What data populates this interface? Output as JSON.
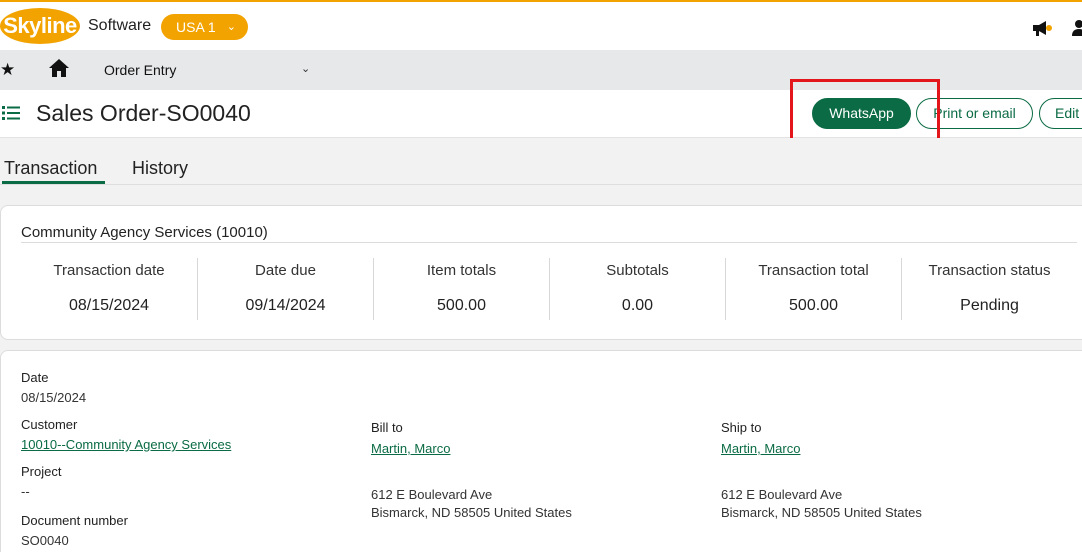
{
  "header": {
    "logo_text": "Skyline",
    "brand_text": "Software",
    "company": "USA 1",
    "company_chevron": "⌄"
  },
  "nav": {
    "star": "★",
    "label": "Order Entry",
    "chevron": "⌄"
  },
  "title": {
    "text": "Sales Order-SO0040",
    "buttons": {
      "whatsapp": "WhatsApp",
      "print": "Print or email",
      "edit": "Edit"
    }
  },
  "tabs": [
    {
      "label": "Transaction",
      "active": true
    },
    {
      "label": "History",
      "active": false
    }
  ],
  "summary": {
    "title": "Community Agency Services (10010)",
    "stats": [
      {
        "label": "Transaction date",
        "value": "08/15/2024"
      },
      {
        "label": "Date due",
        "value": "09/14/2024"
      },
      {
        "label": "Item totals",
        "value": "500.00"
      },
      {
        "label": "Subtotals",
        "value": "0.00"
      },
      {
        "label": "Transaction total",
        "value": "500.00"
      },
      {
        "label": "Transaction status",
        "value": "Pending"
      }
    ]
  },
  "detail": {
    "date_label": "Date",
    "date_value": "08/15/2024",
    "customer_label": "Customer",
    "customer_value": "10010--Community Agency Services",
    "project_label": "Project",
    "project_value": "--",
    "docnum_label": "Document number",
    "docnum_value": "SO0040",
    "bill_to_label": "Bill to",
    "bill_to_name": "Martin, Marco",
    "bill_to_line1": "612 E Boulevard Ave",
    "bill_to_line2": "Bismarck, ND 58505 United States",
    "ship_to_label": "Ship to",
    "ship_to_name": "Martin, Marco",
    "ship_to_line1": "612 E Boulevard Ave",
    "ship_to_line2": "Bismarck, ND 58505 United States"
  },
  "colors": {
    "brand_orange": "#f2a300",
    "primary_green": "#0a6b44",
    "highlight_red": "#e3161b"
  }
}
